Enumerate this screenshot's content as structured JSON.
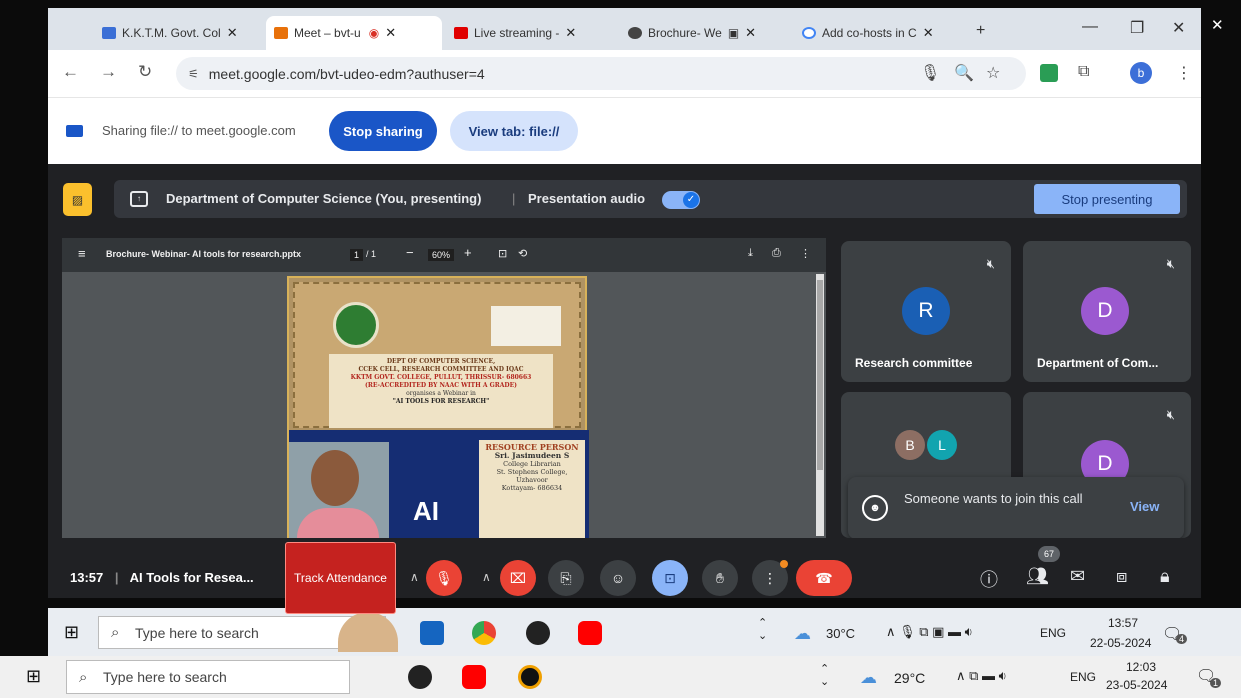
{
  "browser": {
    "tabs": [
      {
        "title": "K.K.T.M. Govt. Col",
        "icon": "calendar-icon",
        "color": "#3b6fd6"
      },
      {
        "title": "Meet – bvt-u",
        "icon": "meet-icon",
        "color": "#e8710a"
      },
      {
        "title": "Live streaming -",
        "icon": "youtube-icon",
        "color": "#e00000"
      },
      {
        "title": "Brochure- We",
        "icon": "chrome-icon",
        "color": "#444444"
      },
      {
        "title": "Add co-hosts in C",
        "icon": "google-icon",
        "color": "#4285f4"
      }
    ],
    "url": "meet.google.com/bvt-udeo-edm?authuser=4",
    "profile_initial": "b"
  },
  "sharing_bar": {
    "text": "Sharing file:// to meet.google.com",
    "stop_sharing": "Stop sharing",
    "view_tab": "View tab: file://"
  },
  "presentation_bar": {
    "title": "Department of Computer Science (You, presenting)",
    "audio_label": "Presentation audio",
    "audio_on": true,
    "stop_presenting": "Stop presenting"
  },
  "pdf_viewer": {
    "filename": "Brochure- Webinar- AI tools for research.pptx",
    "page": "1",
    "pages": "/ 1",
    "zoom": "60%"
  },
  "brochure": {
    "header_lines": [
      "DEPT OF COMPUTER SCIENCE,",
      "CCEK CELL, RESEARCH COMMITTEE AND IQAC",
      "KKTM GOVT. COLLEGE, PULLUT, THRISSUR- 680663",
      "(RE-ACCREDITED BY NAAC WITH A GRADE)",
      "organises a Webinar in",
      "\"AI TOOLS FOR RESEARCH\""
    ],
    "ai_text": "AI",
    "resource_title": "RESOURCE PERSON",
    "resource_lines": [
      "Sri. Jasimudeen S",
      "College Librarian",
      "St. Stephens College,",
      "Uzhavoor",
      "Kottayam- 686634"
    ]
  },
  "participants": [
    {
      "initial": "R",
      "name": "Research committee",
      "color": "#1a5fb4",
      "muted": true
    },
    {
      "initial": "D",
      "name": "Department of Com...",
      "color": "#9b59d0",
      "muted": true
    },
    {
      "initials": [
        "B",
        "L"
      ],
      "colors": [
        "#8d6e63",
        "#12a4af"
      ]
    },
    {
      "initial": "D",
      "color": "#9b59d0",
      "muted": true
    }
  ],
  "join_request": {
    "text": "Someone wants to join this call",
    "action": "View"
  },
  "controls": {
    "time": "13:57",
    "meeting_title": "AI Tools for Resea...",
    "track_attendance": "Track Attendance",
    "participant_count": "67"
  },
  "taskbar_inner": {
    "search_placeholder": "Type here to search",
    "temperature": "30°C",
    "lang": "ENG",
    "time": "13:57",
    "date": "22-05-2024",
    "notifications": "4"
  },
  "taskbar_outer": {
    "search_placeholder": "Type here to search",
    "temperature": "29°C",
    "lang": "ENG",
    "time": "12:03",
    "date": "23-05-2024",
    "notifications": "1"
  }
}
